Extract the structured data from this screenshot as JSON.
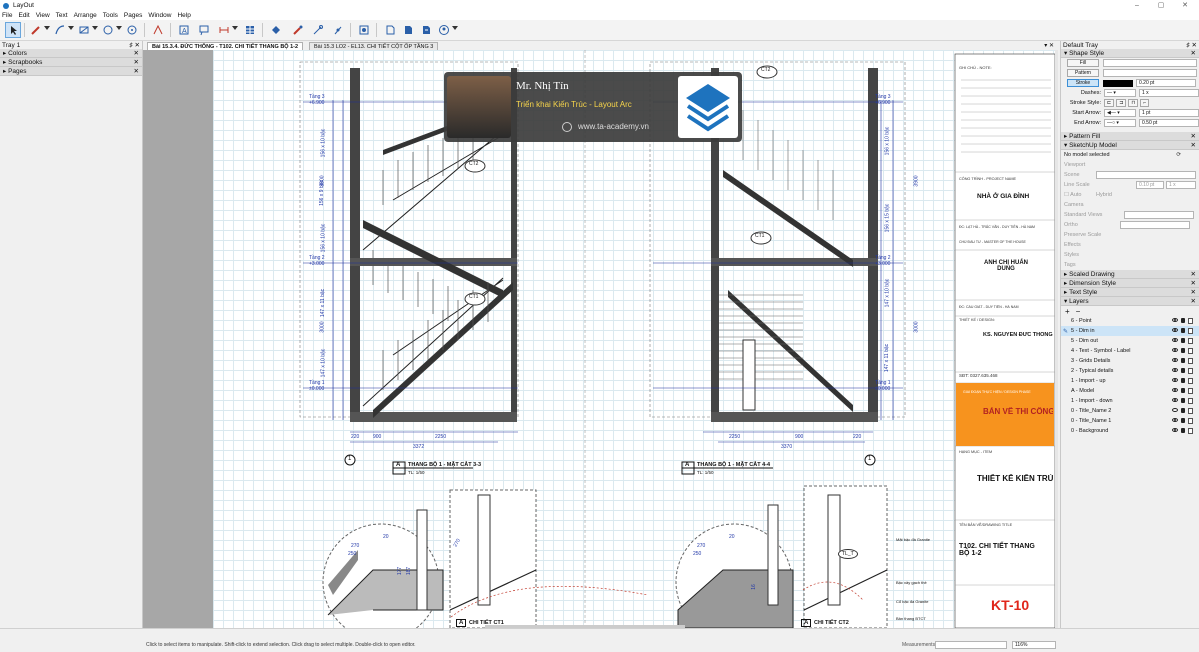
{
  "app": {
    "title": "LayOut",
    "window_controls": [
      "–",
      "▢",
      "✕"
    ]
  },
  "menu": [
    "File",
    "Edit",
    "View",
    "Text",
    "Arrange",
    "Tools",
    "Pages",
    "Window",
    "Help"
  ],
  "left_tray": {
    "title": "Tray 1",
    "controls": "♯ ✕",
    "panels": [
      {
        "label": "Colors",
        "close": "✕"
      },
      {
        "label": "Scrapbooks",
        "close": "✕"
      },
      {
        "label": "Pages",
        "close": "✕"
      }
    ]
  },
  "tabs": [
    {
      "label": "Bài 15.3.4. ĐỨC THÔNG - T102. CHI TIẾT THANG BỘ 1-2",
      "active": true
    },
    {
      "label": "Bài 15.3 LO2 - EL13. CHI TIẾT CỘT ỐP TẦNG 3",
      "active": false
    }
  ],
  "tab_controls": "▾ ✕",
  "drawing": {
    "watermark": {
      "name": "Mr. Nhị Tín",
      "subtitle": "Triển khai Kiến Trúc - Layout Arc",
      "url": "www.ta-academy.vn"
    },
    "left_view": {
      "title": "THANG BỘ 1 - MẶT CẮT 3-3",
      "letter": "A",
      "scale": "TL: 1/50",
      "dims_bottom": [
        "220",
        "900",
        "2250",
        "3372"
      ],
      "dims_side": [
        "156 x 10 bậc",
        "156 x 9 bậc",
        "3900",
        "156 x 10 bậc",
        "147 x 11 bậc",
        "3000",
        "147 x 10 bậc"
      ],
      "levels": [
        "Tầng 3 +6.900",
        "Tầng 2 +3.000",
        "Tầng 1 ±0.000"
      ],
      "tags": [
        "CT2",
        "CT1"
      ],
      "axis": "1"
    },
    "right_view": {
      "title": "THANG BỘ 1 - MẶT CẮT 4-4",
      "letter": "A",
      "scale": "TL: 1/50",
      "dims_bottom": [
        "2250",
        "900",
        "220",
        "3370"
      ],
      "dims_side": [
        "156 x 10 bậc",
        "3900",
        "156 x 15 bậc",
        "147 x 10 bậc",
        "3000",
        "147 x 11 bậc"
      ],
      "levels": [
        "Tầng 3 +6.900",
        "Tầng 2 +3.000",
        "Tầng 1 ±0.000"
      ],
      "tags": [
        "CT2",
        "CT1"
      ],
      "axis": "1"
    },
    "detail_left": {
      "title": "CHI TIẾT CT1",
      "letter": "A",
      "dims": [
        "270",
        "250",
        "20",
        "177",
        "187",
        "270"
      ]
    },
    "detail_right": {
      "title": "CHI TIẾT CT2",
      "letter": "A",
      "dims": [
        "270",
        "250",
        "20",
        "16"
      ],
      "tag": "TL_T",
      "notes": [
        "Mặt bậc đá Granite",
        "Bậc xây gạch thẻ",
        "Cổ bậc đá Granite",
        "Bản thang BTCT"
      ]
    }
  },
  "title_block": {
    "note_label": "GHI CHÚ - NOTE:",
    "project_label": "CÔNG TRÌNH - PROJECT NAME",
    "project": "NHÀ Ở GIA ĐÌNH",
    "address_label": "ĐC: LẠT HÀ - TRẮC VĂN - DUY TIÊN - HÀ NAM",
    "owner_label": "CHỦ ĐẦU TƯ - MASTER OF THE HOUSE",
    "owner": "ANH CHỊ HUẤN DUNG",
    "addr2": "ĐC: CẦU GIÁT - DUY TIÊN - HÀ NAM",
    "designer_label": "THIẾT KẾ / DESIGN:",
    "designer": "KS. NGUYỄN ĐỨC THÔNG",
    "phone": "SĐT: 0327.635.468",
    "stage_label": "GIAI ĐOẠN THỰC HIỆN / DESIGN PHASE",
    "stage": "BẢN VẼ THI CÔNG",
    "item_label": "HẠNG MỤC - ITEM",
    "item": "THIẾT KẾ KIẾN TRÚC",
    "drawing_title_label": "TÊN BẢN VẼ/DRAWING TITLE",
    "drawing_title": "T102. CHI TIẾT THANG BỘ 1-2",
    "sheet": "KT-10"
  },
  "right_tray": {
    "title": "Default Tray",
    "controls": "♯ ✕",
    "shape_style": {
      "header": "Shape Style",
      "fill": "Fill",
      "pattern": "Pattern",
      "stroke": "Stroke",
      "stroke_value": "0.20 pt",
      "dashes_label": "Dashes:",
      "dashes_value": "1 x",
      "stroke_style_label": "Stroke Style:",
      "start_arrow_label": "Start Arrow:",
      "start_arrow_value": "1 pt",
      "end_arrow_label": "End Arrow:",
      "end_arrow_value": "0.50 pt"
    },
    "pattern_fill": "Pattern Fill",
    "sketchup_model": {
      "header": "SketchUp Model",
      "no_model": "No model selected",
      "viewport": "Viewport",
      "scene": "Scene",
      "line_scale": "Line Scale",
      "line_scale_value": "0.10 pt",
      "line_scale_mult": "1 x",
      "auto": "Auto",
      "hybrid": "Hybrid",
      "camera": "Camera",
      "standard_views": "Standard Views",
      "ortho": "Ortho",
      "preserve_scale": "Preserve Scale",
      "effects": "Effects",
      "styles": "Styles",
      "tags": "Tags"
    },
    "panels": [
      "Scaled Drawing",
      "Dimension Style",
      "Text Style"
    ],
    "layers": {
      "header": "Layers",
      "add": "+",
      "remove": "−",
      "items": [
        {
          "name": "6 - Point",
          "visible": true,
          "selected": false
        },
        {
          "name": "5 - Dim in",
          "visible": true,
          "selected": true
        },
        {
          "name": "5 - Dim out",
          "visible": true,
          "selected": false
        },
        {
          "name": "4 - Text - Symbol - Label",
          "visible": true,
          "selected": false
        },
        {
          "name": "3 - Grids Details",
          "visible": true,
          "selected": false
        },
        {
          "name": "2 - Typical details",
          "visible": true,
          "selected": false
        },
        {
          "name": "1 - Import - up",
          "visible": true,
          "selected": false
        },
        {
          "name": "A - Model",
          "visible": true,
          "selected": false
        },
        {
          "name": "1 - Import - down",
          "visible": true,
          "selected": false
        },
        {
          "name": "0 - Title_Name 2",
          "visible": false,
          "selected": false
        },
        {
          "name": "0 - Title_Name 1",
          "visible": true,
          "selected": false
        },
        {
          "name": "0 - Background",
          "visible": true,
          "selected": false
        }
      ]
    }
  },
  "status": {
    "hint": "Click to select items to manipulate. Shift-click to extend selection. Click drag to select multiple. Double-click to open editor.",
    "measurements_label": "Measurements",
    "zoom": "116%"
  },
  "colors": {
    "accent": "#1e73be",
    "stage_bg": "#f7931e",
    "sheet_red": "#e0261b",
    "dim_blue": "#2238a8",
    "selection": "#cce4f7"
  }
}
